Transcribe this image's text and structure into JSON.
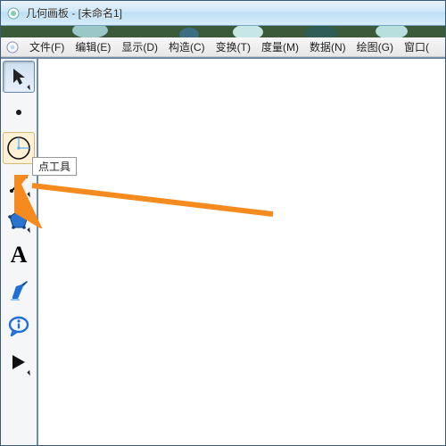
{
  "title": "几何画板 - [未命名1]",
  "menu": {
    "items": [
      {
        "label": "文件(F)"
      },
      {
        "label": "编辑(E)"
      },
      {
        "label": "显示(D)"
      },
      {
        "label": "构造(C)"
      },
      {
        "label": "变换(T)"
      },
      {
        "label": "度量(M)"
      },
      {
        "label": "数据(N)"
      },
      {
        "label": "绘图(G)"
      },
      {
        "label": "窗口("
      }
    ]
  },
  "tooltip": {
    "text": "点工具"
  },
  "tools": {
    "selection": "selection-arrow",
    "point": "point",
    "compass": "compass",
    "line": "line",
    "polygon": "polygon",
    "text": "text-A",
    "marker": "marker",
    "info": "info",
    "custom": "custom-tools"
  },
  "colors": {
    "accent_blue": "#1f6fd6",
    "arrow_orange": "#f58a1f"
  }
}
